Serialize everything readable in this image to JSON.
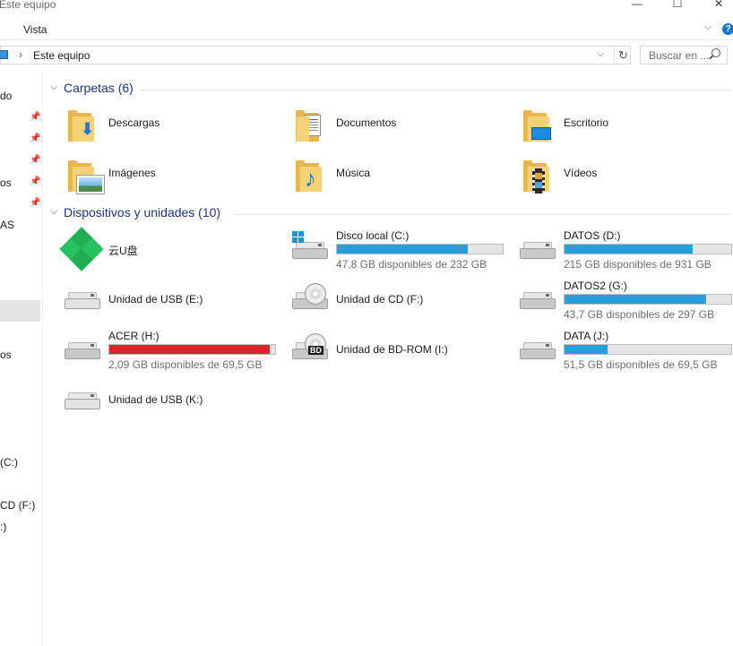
{
  "window": {
    "title": "Este equipo",
    "minimize": "—",
    "maximize": "☐",
    "close": "✕"
  },
  "ribbon": {
    "tab": "Vista",
    "expand": "⌵",
    "help": "?"
  },
  "address": {
    "crumb_sep": "›",
    "crumb": "Este equipo",
    "dropdown": "⌵",
    "refresh": "↻"
  },
  "search": {
    "placeholder": "Buscar en ..."
  },
  "sidebar": {
    "items": [
      "do",
      "os",
      "AS",
      "os",
      "(C:)",
      "CD (F:)",
      ":)"
    ]
  },
  "folders_group": {
    "chevron": "⌵",
    "title": "Carpetas (6)",
    "items": [
      "Descargas",
      "Documentos",
      "Escritorio",
      "Imágenes",
      "Música",
      "Vídeos"
    ]
  },
  "devices_group": {
    "chevron": "⌵",
    "title": "Dispositivos y unidades (10)",
    "drives": [
      {
        "name": "云U盘"
      },
      {
        "name": "Disco local (C:)",
        "free": "47,8 GB disponibles de 232 GB",
        "used_fraction": 0.79,
        "color": "#26a0da"
      },
      {
        "name": "DATOS (D:)",
        "free": "215 GB disponibles de 931 GB",
        "used_fraction": 0.77,
        "color": "#26a0da"
      },
      {
        "name": "Unidad de USB (E:)"
      },
      {
        "name": "Unidad de CD (F:)"
      },
      {
        "name": "DATOS2 (G:)",
        "free": "43,7 GB disponibles de 297 GB",
        "used_fraction": 0.85,
        "color": "#26a0da"
      },
      {
        "name": "ACER (H:)",
        "free": "2,09 GB disponibles de 69,5 GB",
        "used_fraction": 0.97,
        "color": "#da2626"
      },
      {
        "name": "Unidad de BD-ROM (I:)",
        "badge": "BD"
      },
      {
        "name": "DATA (J:)",
        "free": "51,5 GB disponibles de 69,5 GB",
        "used_fraction": 0.26,
        "color": "#26a0da"
      },
      {
        "name": "Unidad de USB (K:)"
      }
    ]
  }
}
